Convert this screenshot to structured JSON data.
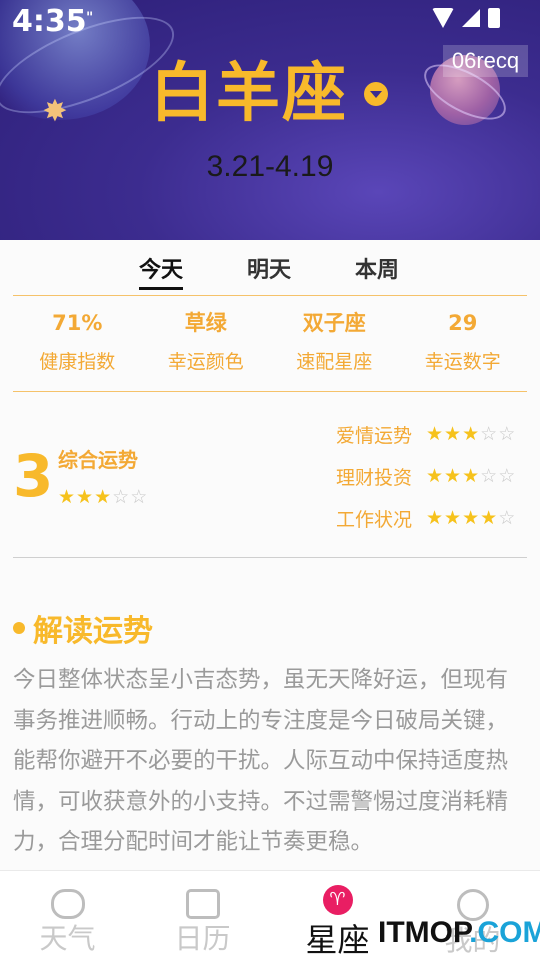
{
  "status_bar": {
    "time": "4:35",
    "dnd": "\""
  },
  "header": {
    "tag": "06recq",
    "sign_name": "白羊座",
    "dates": "3.21-4.19"
  },
  "tabs": [
    {
      "label": "今天",
      "active": true
    },
    {
      "label": "明天",
      "active": false
    },
    {
      "label": "本周",
      "active": false
    }
  ],
  "stats": [
    {
      "value": "71%",
      "label": "健康指数"
    },
    {
      "value": "草绿",
      "label": "幸运颜色"
    },
    {
      "value": "双子座",
      "label": "速配星座"
    },
    {
      "value": "29",
      "label": "幸运数字"
    }
  ],
  "overall": {
    "score": "3",
    "label": "综合运势",
    "stars": 3,
    "max_stars": 5
  },
  "ratings": [
    {
      "label": "爱情运势",
      "stars": 3,
      "max_stars": 5
    },
    {
      "label": "理财投资",
      "stars": 3,
      "max_stars": 5
    },
    {
      "label": "工作状况",
      "stars": 4,
      "max_stars": 5
    }
  ],
  "reading": {
    "title": "解读运势",
    "body": "今日整体状态呈小吉态势，虽无天降好运，但现有事务推进顺畅。行动上的专注度是今日破局关键，能帮你避开不必要的干扰。人际互动中保持适度热情，可收获意外的小支持。不过需警惕过度消耗精力，合理分配时间才能让节奏更稳。"
  },
  "bottom_nav": [
    {
      "label": "天气",
      "icon": "cloud-face-icon",
      "active": false
    },
    {
      "label": "日历",
      "icon": "calendar-icon",
      "active": false
    },
    {
      "label": "星座",
      "icon": "aries-icon",
      "active": true
    },
    {
      "label": "我的",
      "icon": "smiley-icon",
      "active": false
    }
  ],
  "watermark": {
    "part1": "ITMOP",
    "part2": ".COM"
  },
  "colors": {
    "accent": "#f8b92b",
    "header_bg": "#3c2c8f",
    "active_icon": "#e91e63"
  }
}
